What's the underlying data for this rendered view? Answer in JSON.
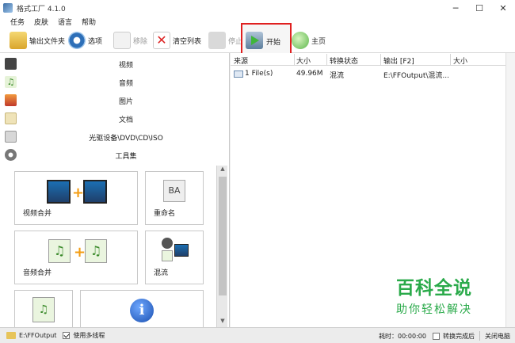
{
  "window": {
    "title": "格式工厂 4.1.0"
  },
  "menu": {
    "items": [
      "任务",
      "皮肤",
      "语言",
      "帮助"
    ]
  },
  "toolbar": {
    "output_folder": "输出文件夹",
    "options": "选项",
    "remove": "移除",
    "clear_list": "清空列表",
    "stop": "停止",
    "start": "开始",
    "home": "主页"
  },
  "categories": [
    "视频",
    "音频",
    "图片",
    "文档",
    "光驱设备\\DVD\\CD\\ISO",
    "工具集"
  ],
  "tools": {
    "video_merge": "视频合并",
    "rename": "重命名",
    "audio_merge": "音频合并",
    "mux": "混流"
  },
  "task_list": {
    "headers": [
      "来源",
      "大小",
      "转换状态",
      "输出 [F2]",
      "大小"
    ],
    "rows": [
      {
        "source": "1 File(s)",
        "size": "49.96M",
        "status": "混流",
        "output": "E:\\FFOutput\\混流...",
        "out_size": ""
      }
    ]
  },
  "watermark": {
    "title": "百科全说",
    "subtitle": "助你轻松解决"
  },
  "status": {
    "output_path": "E:\\FFOutput",
    "multithread_label": "使用多线程",
    "multithread_checked": true,
    "elapsed": "耗时：00:00:00",
    "after_convert_label": "转换完成后",
    "after_convert_checked": false,
    "action": "关闭电脑"
  }
}
